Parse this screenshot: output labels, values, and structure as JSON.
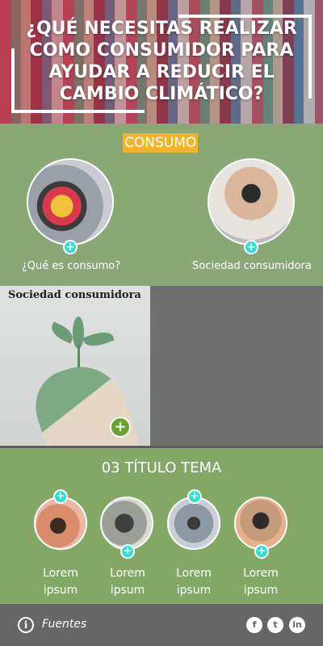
{
  "header": {
    "title": "¿QUÉ NECESITAS REALIZAR COMO CONSUMIDOR PARA AYUDAR A REDUCIR EL CAMBIO CLIMÁTICO?"
  },
  "consumo": {
    "badge": "CONSUMO",
    "items": [
      {
        "label": "¿Qué es consumo?",
        "icon": "plus-icon"
      },
      {
        "label": "Sociedad consumidora",
        "icon": "plus-icon"
      }
    ]
  },
  "middle": {
    "image_title": "Sociedad consumidora",
    "plus_icon": "plus-icon"
  },
  "tema": {
    "title": "03 TÍTULO TEMA",
    "items": [
      {
        "label": "Lorem ipsum"
      },
      {
        "label": "Lorem ipsum"
      },
      {
        "label": "Lorem ipsum"
      },
      {
        "label": "Lorem ipsum"
      }
    ]
  },
  "footer": {
    "info_icon": "i",
    "sources_label": "Fuentes",
    "social": {
      "facebook": "f",
      "twitter": "t",
      "linkedin": "in"
    }
  },
  "colors": {
    "consumo_bg": "#8aa876",
    "badge_bg": "#f1b52b",
    "plus": "#2fe0d2",
    "tema_bg": "#83a866",
    "footer_bg": "#666666"
  }
}
